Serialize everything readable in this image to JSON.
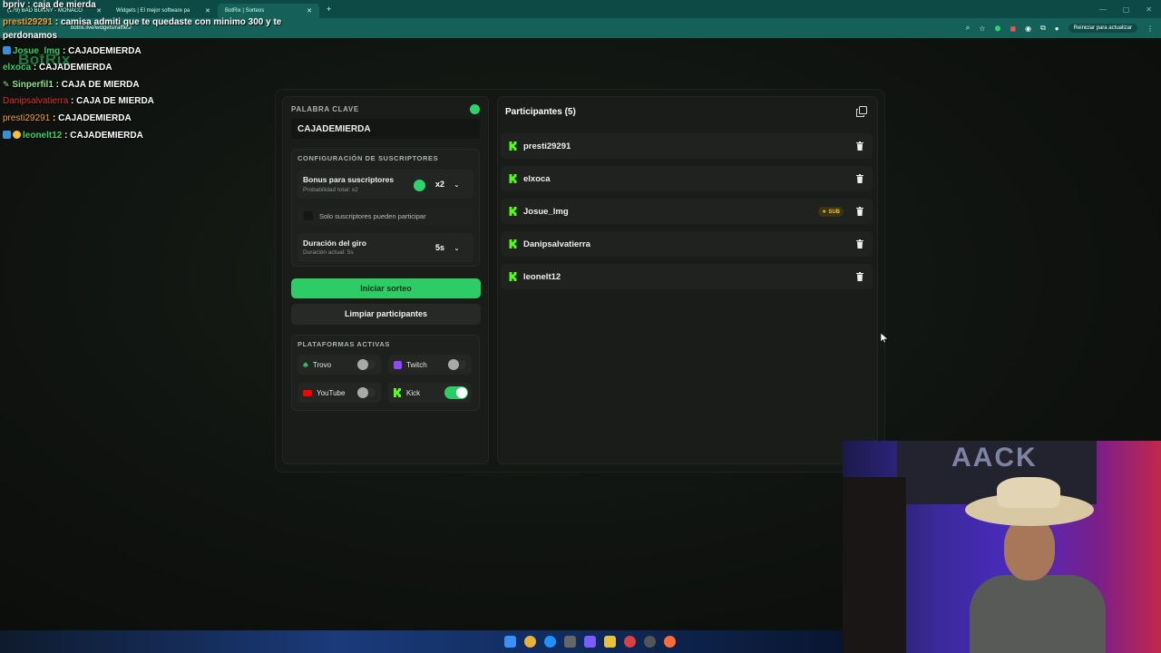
{
  "browser": {
    "tabs": [
      {
        "label": "(179) BAD BUNNY - MONACO",
        "active": false
      },
      {
        "label": "Widgets | El mejor software pa",
        "active": false
      },
      {
        "label": "BotRix | Sorteos",
        "active": true
      }
    ],
    "url": "botrix.live/widgets/raffles/",
    "reload_label": "Reiniciar para actualizar"
  },
  "chat": [
    {
      "user": "bpriv",
      "message": "caja de mierda",
      "user_color": "#ffffff"
    },
    {
      "user": "presti29291",
      "message": "camisa admiti que te quedaste con minimo 300 y te perdonamos",
      "user_color": "#f0a030"
    },
    {
      "user": "Josue_lmg",
      "message": "CAJADEMIERDA",
      "user_color": "#2fd36b"
    },
    {
      "user": "elxoca",
      "message": "CAJADEMIERDA",
      "user_color": "#2fd36b"
    },
    {
      "user": "Sinperfil1",
      "message": "CAJA DE MIERDA",
      "user_color": "#8fe08f"
    },
    {
      "user": "Danipsalvatierra",
      "message": "CAJA DE MIERDA",
      "user_color": "#e0302a"
    },
    {
      "user": "presti29291",
      "message": "CAJADEMIERDA",
      "user_color": "#f0a030"
    },
    {
      "user": "leonelt12",
      "message": "CAJADEMIERDA",
      "user_color": "#2fd36b"
    }
  ],
  "logo_text": "BotRix",
  "settings": {
    "keyword_label": "PALABRA CLAVE",
    "keyword_value": "CAJADEMIERDA",
    "subs_section_label": "CONFIGURACIÓN DE SUSCRIPTORES",
    "bonus_label": "Bonus para suscriptores",
    "bonus_sub": "Probabilidad total: x2",
    "bonus_value": "x2",
    "only_subs_label": "Solo suscriptores pueden participar",
    "spin_label": "Duración del giro",
    "spin_sub": "Duración actual: 5s",
    "spin_value": "5s",
    "start_button": "Iniciar sorteo",
    "clear_button": "Limpiar participantes",
    "platforms_label": "PLATAFORMAS ACTIVAS",
    "platforms": [
      {
        "name": "Trovo",
        "enabled": false,
        "color": "#2fd36b"
      },
      {
        "name": "Twitch",
        "enabled": false,
        "color": "#9146ff"
      },
      {
        "name": "YouTube",
        "enabled": false,
        "color": "#ff0000"
      },
      {
        "name": "Kick",
        "enabled": true,
        "color": "#53fc18"
      }
    ]
  },
  "participants": {
    "title": "Participantes (5)",
    "list": [
      {
        "name": "presti29291",
        "sub": false
      },
      {
        "name": "elxoca",
        "sub": false
      },
      {
        "name": "Josue_lmg",
        "sub": true
      },
      {
        "name": "Danipsalvatierra",
        "sub": false
      },
      {
        "name": "leonelt12",
        "sub": false
      }
    ],
    "sub_tag": "SUB"
  },
  "webcam": {
    "wall_text": "AACK"
  },
  "colors": {
    "accent": "#2ecc66",
    "kick": "#53fc18",
    "sub_tag": "#f1c232"
  }
}
